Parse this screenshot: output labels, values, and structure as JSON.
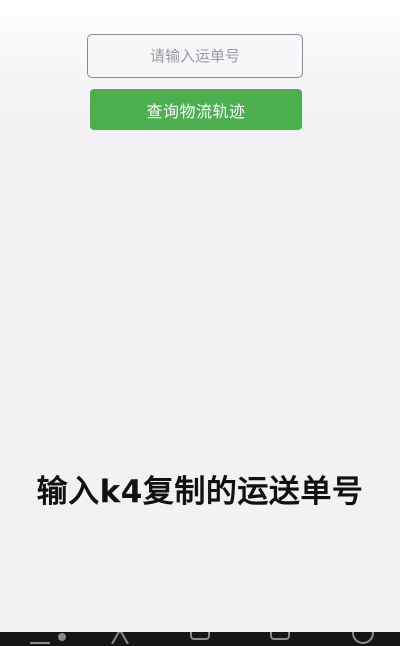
{
  "tracking": {
    "input_placeholder": "请输入运单号",
    "input_value": "",
    "query_button_label": "查询物流轨迹"
  },
  "caption": {
    "text": "输入k4复制的运送单号"
  },
  "colors": {
    "button_green": "#4caf50",
    "background": "#f3f1f4",
    "nav_bar": "#151517"
  },
  "icons": {
    "nav": [
      "menu-icon",
      "dot-icon",
      "home-icon",
      "back-icon",
      "recent-apps-icon",
      "assistant-circle-icon"
    ]
  }
}
